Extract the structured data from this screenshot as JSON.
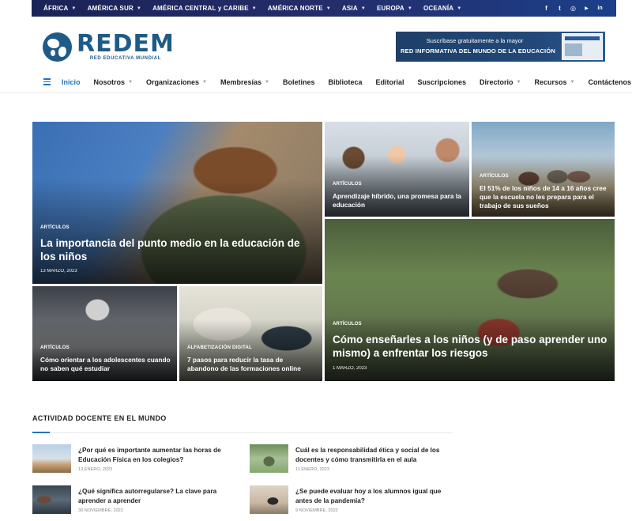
{
  "topbar": {
    "regions": [
      {
        "label": "ÁFRICA"
      },
      {
        "label": "AMÉRICA SUR"
      },
      {
        "label": "AMÉRICA CENTRAL y CARIBE"
      },
      {
        "label": "AMÉRICA NORTE"
      },
      {
        "label": "ASIA"
      },
      {
        "label": "EUROPA"
      },
      {
        "label": "OCEANÍA"
      }
    ],
    "socials": [
      {
        "icon": "facebook-icon",
        "glyph": "f"
      },
      {
        "icon": "twitter-icon",
        "glyph": "t"
      },
      {
        "icon": "instagram-icon",
        "glyph": "◎"
      },
      {
        "icon": "youtube-icon",
        "glyph": "▶"
      },
      {
        "icon": "linkedin-icon",
        "glyph": "in"
      }
    ]
  },
  "header": {
    "logo_title": "REDEM",
    "logo_subtitle": "RED EDUCATIVA MUNDIAL",
    "banner_line1": "Suscríbase gratuitamente a la mayor",
    "banner_line2": "RED INFORMATIVA DEL MUNDO DE LA EDUCACIÓN"
  },
  "nav": {
    "items": [
      {
        "label": "Inicio",
        "active": true,
        "dropdown": false
      },
      {
        "label": "Nosotros",
        "active": false,
        "dropdown": true
      },
      {
        "label": "Organizaciones",
        "active": false,
        "dropdown": true
      },
      {
        "label": "Membresías",
        "active": false,
        "dropdown": true
      },
      {
        "label": "Boletines",
        "active": false,
        "dropdown": false
      },
      {
        "label": "Biblioteca",
        "active": false,
        "dropdown": false
      },
      {
        "label": "Editorial",
        "active": false,
        "dropdown": false
      },
      {
        "label": "Suscripciones",
        "active": false,
        "dropdown": false
      },
      {
        "label": "Directorio",
        "active": false,
        "dropdown": true
      },
      {
        "label": "Recursos",
        "active": false,
        "dropdown": true
      },
      {
        "label": "Contáctenos",
        "active": false,
        "dropdown": false
      }
    ]
  },
  "featured": {
    "c1": {
      "category": "ARTÍCULOS",
      "title": "La importancia del punto medio en la educación de los niños",
      "date": "13 MARZO, 2023"
    },
    "c2": {
      "category": "ARTÍCULOS",
      "title": "Aprendizaje híbrido, una promesa para la educación",
      "date": ""
    },
    "c3": {
      "category": "ARTÍCULOS",
      "title": "El 51% de los niños de 14 a 16 años cree que la escuela no les prepara para el trabajo de sus sueños",
      "date": ""
    },
    "c4": {
      "category": "ARTÍCULOS",
      "title": "Cómo enseñarles a los niños (y de paso aprender uno mismo) a enfrentar los riesgos",
      "date": "1 MARZO, 2023"
    },
    "c5": {
      "category": "ARTÍCULOS",
      "title": "Cómo orientar a los adolescentes cuando no saben qué estudiar",
      "date": ""
    },
    "c6": {
      "category": "ALFABETIZACIÓN DIGITAL",
      "title": "7 pasos para reducir la tasa de abandono de las formaciones online",
      "date": ""
    }
  },
  "section": {
    "title": "ACTIVIDAD DOCENTE EN EL MUNDO",
    "posts": [
      {
        "title": "¿Por qué es importante aumentar las horas de Educación Física en los colegios?",
        "date": "13 ENERO, 2023"
      },
      {
        "title": "Cuál es la responsabilidad ética y social de los docentes y cómo transmitirla en el aula",
        "date": "11 ENERO, 2023"
      },
      {
        "title": "¿Qué significa autorregularse? La clave para aprender a aprender",
        "date": "30 NOVIEMBRE, 2022"
      },
      {
        "title": "¿Se puede evaluar hoy a los alumnos igual que antes de la pandemia?",
        "date": "9 NOVIEMBRE, 2022"
      }
    ]
  },
  "colors": {
    "accent": "#1e73be",
    "brand": "#1e5b86",
    "topbar": "#1a2357"
  }
}
